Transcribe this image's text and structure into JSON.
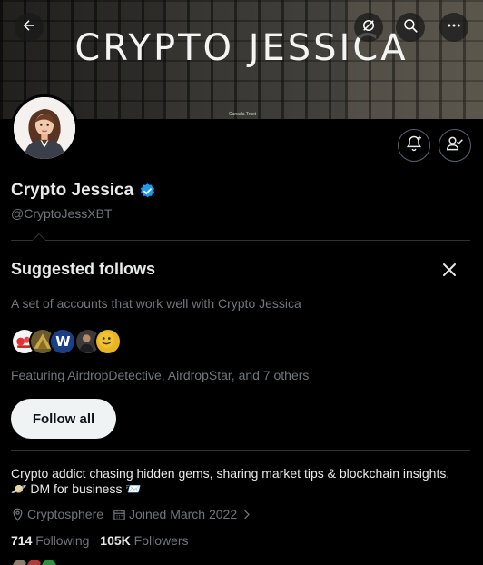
{
  "banner": {
    "title": "CRYPTO JESSICA",
    "sign_text": "Canada Trust"
  },
  "header_buttons": {
    "back_icon": "back-arrow-icon",
    "no_image_icon": "slashed-circle-icon",
    "search_icon": "search-icon",
    "more_icon": "more-horizontal-icon"
  },
  "profile": {
    "display_name": "Crypto Jessica",
    "handle": "@CryptoJessXBT",
    "verified": true,
    "verified_color": "#1d9bf0",
    "notify_icon": "bell-plus-icon",
    "follow_icon": "person-check-icon"
  },
  "suggested_follows": {
    "title": "Suggested follows",
    "subtitle": "A set of accounts that work well with Crypto Jessica",
    "featuring": "Featuring AirdropDetective, AirdropStar, and 7 others",
    "follow_all_label": "Follow all",
    "mini_avatar_letter": "W"
  },
  "bio": {
    "line1": "Crypto addict chasing hidden gems, sharing market tips & blockchain insights.",
    "line2_emoji": "🪐",
    "line2": "DM for business",
    "line2_trailing_emoji": "📨"
  },
  "meta": {
    "location": "Cryptosphere",
    "joined": "Joined March 2022"
  },
  "stats": {
    "following_count": "714",
    "following_label": "Following",
    "followers_count": "105K",
    "followers_label": "Followers"
  },
  "colors": {
    "background": "#000000",
    "primary_text": "#e7e9ea",
    "secondary_text": "#71767b",
    "divider": "#2f3336",
    "button_bg": "#eff3f4"
  }
}
